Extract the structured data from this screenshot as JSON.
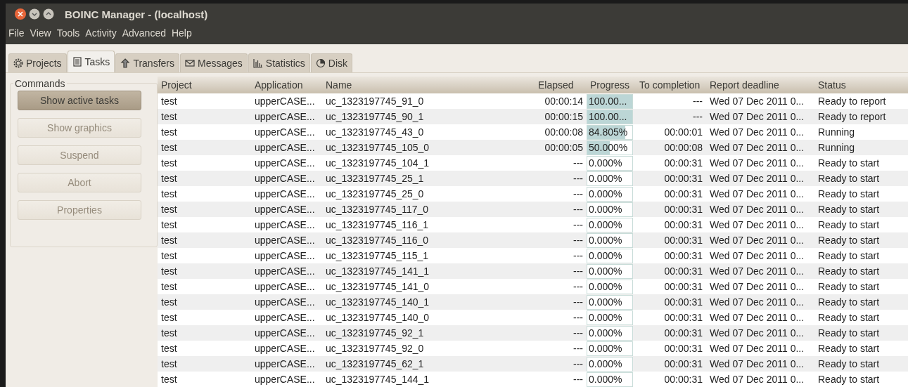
{
  "window": {
    "title": "BOINC Manager - (localhost)"
  },
  "menu": [
    "File",
    "View",
    "Tools",
    "Activity",
    "Advanced",
    "Help"
  ],
  "tabs": [
    {
      "label": "Projects",
      "selected": false
    },
    {
      "label": "Tasks",
      "selected": true
    },
    {
      "label": "Transfers",
      "selected": false
    },
    {
      "label": "Messages",
      "selected": false
    },
    {
      "label": "Statistics",
      "selected": false
    },
    {
      "label": "Disk",
      "selected": false
    }
  ],
  "commands": {
    "title": "Commands",
    "buttons": [
      {
        "label": "Show active tasks",
        "pressed": true,
        "disabled": false
      },
      {
        "label": "Show graphics",
        "pressed": false,
        "disabled": true
      },
      {
        "label": "Suspend",
        "pressed": false,
        "disabled": true
      },
      {
        "label": "Abort",
        "pressed": false,
        "disabled": true
      },
      {
        "label": "Properties",
        "pressed": false,
        "disabled": true
      }
    ]
  },
  "table": {
    "columns": [
      "Project",
      "Application",
      "Name",
      "Elapsed",
      "Progress",
      "To completion",
      "Report deadline",
      "Status"
    ],
    "rows": [
      {
        "project": "test",
        "application": "upperCASE...",
        "name": "uc_1323197745_91_0",
        "elapsed": "00:00:14",
        "progress": {
          "text": "100.00...",
          "level": 1
        },
        "to_completion": "---",
        "deadline": "Wed 07 Dec 2011 0...",
        "status": "Ready to report"
      },
      {
        "project": "test",
        "application": "upperCASE...",
        "name": "uc_1323197745_90_1",
        "elapsed": "00:00:15",
        "progress": {
          "text": "100.00...",
          "level": 1
        },
        "to_completion": "---",
        "deadline": "Wed 07 Dec 2011 0...",
        "status": "Ready to report"
      },
      {
        "project": "test",
        "application": "upperCASE...",
        "name": "uc_1323197745_43_0",
        "elapsed": "00:00:08",
        "progress": {
          "text": "84.805%",
          "level": 0.848
        },
        "to_completion": "00:00:01",
        "deadline": "Wed 07 Dec 2011 0...",
        "status": "Running"
      },
      {
        "project": "test",
        "application": "upperCASE...",
        "name": "uc_1323197745_105_0",
        "elapsed": "00:00:05",
        "progress": {
          "text": "50.000%",
          "level": 0.5
        },
        "to_completion": "00:00:08",
        "deadline": "Wed 07 Dec 2011 0...",
        "status": "Running"
      },
      {
        "project": "test",
        "application": "upperCASE...",
        "name": "uc_1323197745_104_1",
        "elapsed": "---",
        "progress": {
          "text": "0.000%",
          "level": 0
        },
        "to_completion": "00:00:31",
        "deadline": "Wed 07 Dec 2011 0...",
        "status": "Ready to start"
      },
      {
        "project": "test",
        "application": "upperCASE...",
        "name": "uc_1323197745_25_1",
        "elapsed": "---",
        "progress": {
          "text": "0.000%",
          "level": 0
        },
        "to_completion": "00:00:31",
        "deadline": "Wed 07 Dec 2011 0...",
        "status": "Ready to start"
      },
      {
        "project": "test",
        "application": "upperCASE...",
        "name": "uc_1323197745_25_0",
        "elapsed": "---",
        "progress": {
          "text": "0.000%",
          "level": 0
        },
        "to_completion": "00:00:31",
        "deadline": "Wed 07 Dec 2011 0...",
        "status": "Ready to start"
      },
      {
        "project": "test",
        "application": "upperCASE...",
        "name": "uc_1323197745_117_0",
        "elapsed": "---",
        "progress": {
          "text": "0.000%",
          "level": 0
        },
        "to_completion": "00:00:31",
        "deadline": "Wed 07 Dec 2011 0...",
        "status": "Ready to start"
      },
      {
        "project": "test",
        "application": "upperCASE...",
        "name": "uc_1323197745_116_1",
        "elapsed": "---",
        "progress": {
          "text": "0.000%",
          "level": 0
        },
        "to_completion": "00:00:31",
        "deadline": "Wed 07 Dec 2011 0...",
        "status": "Ready to start"
      },
      {
        "project": "test",
        "application": "upperCASE...",
        "name": "uc_1323197745_116_0",
        "elapsed": "---",
        "progress": {
          "text": "0.000%",
          "level": 0
        },
        "to_completion": "00:00:31",
        "deadline": "Wed 07 Dec 2011 0...",
        "status": "Ready to start"
      },
      {
        "project": "test",
        "application": "upperCASE...",
        "name": "uc_1323197745_115_1",
        "elapsed": "---",
        "progress": {
          "text": "0.000%",
          "level": 0
        },
        "to_completion": "00:00:31",
        "deadline": "Wed 07 Dec 2011 0...",
        "status": "Ready to start"
      },
      {
        "project": "test",
        "application": "upperCASE...",
        "name": "uc_1323197745_141_1",
        "elapsed": "---",
        "progress": {
          "text": "0.000%",
          "level": 0
        },
        "to_completion": "00:00:31",
        "deadline": "Wed 07 Dec 2011 0...",
        "status": "Ready to start"
      },
      {
        "project": "test",
        "application": "upperCASE...",
        "name": "uc_1323197745_141_0",
        "elapsed": "---",
        "progress": {
          "text": "0.000%",
          "level": 0
        },
        "to_completion": "00:00:31",
        "deadline": "Wed 07 Dec 2011 0...",
        "status": "Ready to start"
      },
      {
        "project": "test",
        "application": "upperCASE...",
        "name": "uc_1323197745_140_1",
        "elapsed": "---",
        "progress": {
          "text": "0.000%",
          "level": 0
        },
        "to_completion": "00:00:31",
        "deadline": "Wed 07 Dec 2011 0...",
        "status": "Ready to start"
      },
      {
        "project": "test",
        "application": "upperCASE...",
        "name": "uc_1323197745_140_0",
        "elapsed": "---",
        "progress": {
          "text": "0.000%",
          "level": 0
        },
        "to_completion": "00:00:31",
        "deadline": "Wed 07 Dec 2011 0...",
        "status": "Ready to start"
      },
      {
        "project": "test",
        "application": "upperCASE...",
        "name": "uc_1323197745_92_1",
        "elapsed": "---",
        "progress": {
          "text": "0.000%",
          "level": 0
        },
        "to_completion": "00:00:31",
        "deadline": "Wed 07 Dec 2011 0...",
        "status": "Ready to start"
      },
      {
        "project": "test",
        "application": "upperCASE...",
        "name": "uc_1323197745_92_0",
        "elapsed": "---",
        "progress": {
          "text": "0.000%",
          "level": 0
        },
        "to_completion": "00:00:31",
        "deadline": "Wed 07 Dec 2011 0...",
        "status": "Ready to start"
      },
      {
        "project": "test",
        "application": "upperCASE...",
        "name": "uc_1323197745_62_1",
        "elapsed": "---",
        "progress": {
          "text": "0.000%",
          "level": 0
        },
        "to_completion": "00:00:31",
        "deadline": "Wed 07 Dec 2011 0...",
        "status": "Ready to start"
      },
      {
        "project": "test",
        "application": "upperCASE...",
        "name": "uc_1323197745_144_1",
        "elapsed": "---",
        "progress": {
          "text": "0.000%",
          "level": 0
        },
        "to_completion": "00:00:31",
        "deadline": "Wed 07 Dec 2011 0...",
        "status": "Ready to start"
      }
    ]
  }
}
